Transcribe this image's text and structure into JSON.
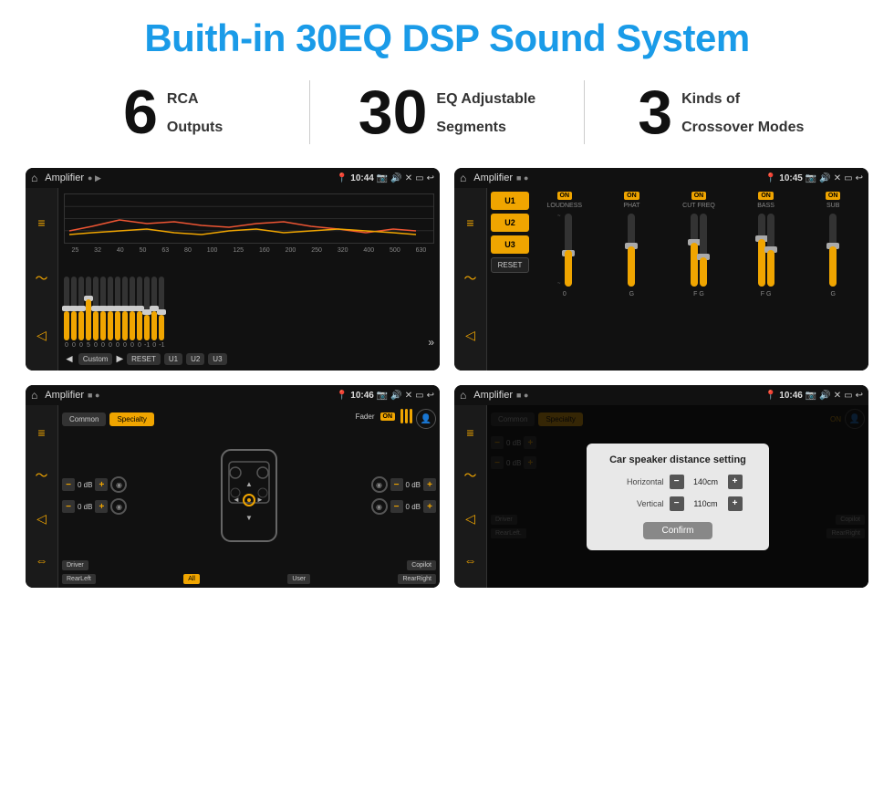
{
  "page": {
    "title": "Buith-in 30EQ DSP Sound System"
  },
  "stats": [
    {
      "number": "6",
      "text_line1": "RCA",
      "text_line2": "Outputs"
    },
    {
      "number": "30",
      "text_line1": "EQ Adjustable",
      "text_line2": "Segments"
    },
    {
      "number": "3",
      "text_line1": "Kinds of",
      "text_line2": "Crossover Modes"
    }
  ],
  "screens": [
    {
      "id": "screen1",
      "title": "Amplifier",
      "time": "10:44",
      "type": "eq"
    },
    {
      "id": "screen2",
      "title": "Amplifier",
      "time": "10:45",
      "type": "amp"
    },
    {
      "id": "screen3",
      "title": "Amplifier",
      "time": "10:46",
      "type": "crossover"
    },
    {
      "id": "screen4",
      "title": "Amplifier",
      "time": "10:46",
      "type": "distance"
    }
  ],
  "eq": {
    "frequencies": [
      "25",
      "32",
      "40",
      "50",
      "63",
      "80",
      "100",
      "125",
      "160",
      "200",
      "250",
      "320",
      "400",
      "500",
      "630"
    ],
    "values": [
      "0",
      "0",
      "0",
      "5",
      "0",
      "0",
      "0",
      "0",
      "0",
      "0",
      "0",
      "-1",
      "0",
      "-1"
    ],
    "buttons": [
      "Custom",
      "RESET",
      "U1",
      "U2",
      "U3"
    ]
  },
  "amp": {
    "presets": [
      "U1",
      "U2",
      "U3"
    ],
    "controls": [
      {
        "label": "LOUDNESS",
        "on": true
      },
      {
        "label": "PHAT",
        "on": true
      },
      {
        "label": "CUT FREQ",
        "on": true
      },
      {
        "label": "BASS",
        "on": true
      },
      {
        "label": "SUB",
        "on": true
      }
    ],
    "reset_label": "RESET"
  },
  "crossover": {
    "tabs": [
      "Common",
      "Specialty"
    ],
    "fader_label": "Fader",
    "fader_on": "ON",
    "channels_left": [
      {
        "label": "0 dB"
      },
      {
        "label": "0 dB"
      }
    ],
    "channels_right": [
      {
        "label": "0 dB"
      },
      {
        "label": "0 dB"
      }
    ],
    "bottom_buttons": [
      "Driver",
      "",
      "Copilot",
      "RearLeft",
      "All",
      "User",
      "RearRight"
    ]
  },
  "distance": {
    "tabs": [
      "Common",
      "Specialty"
    ],
    "modal_title": "Car speaker distance setting",
    "horizontal_label": "Horizontal",
    "horizontal_value": "140cm",
    "vertical_label": "Vertical",
    "vertical_value": "110cm",
    "confirm_label": "Confirm",
    "channels_right": [
      {
        "label": "0 dB"
      },
      {
        "label": "0 dB"
      }
    ],
    "bottom_buttons": [
      "Driver",
      "",
      "Copilot",
      "RearLeft",
      "All",
      "User",
      "RearRight"
    ]
  }
}
